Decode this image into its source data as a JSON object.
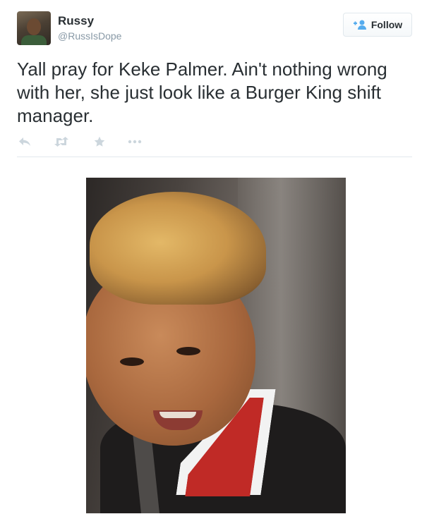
{
  "tweet": {
    "user": {
      "name": "Russy",
      "handle": "@RussIsDope"
    },
    "follow_button": {
      "label": "Follow",
      "icon": "follow-person-plus-icon"
    },
    "text": "Yall pray for Keke Palmer. Ain't nothing wrong with her, she just look like a Burger King shift manager.",
    "actions": [
      {
        "icon": "reply-icon"
      },
      {
        "icon": "retweet-icon"
      },
      {
        "icon": "favorite-star-icon"
      },
      {
        "icon": "more-dots-icon"
      }
    ],
    "colors": {
      "text": "#292f33",
      "muted": "#8899a6",
      "icon": "#ccd6dd",
      "follow_icon": "#55acee",
      "divider": "#e1e8ed"
    }
  }
}
